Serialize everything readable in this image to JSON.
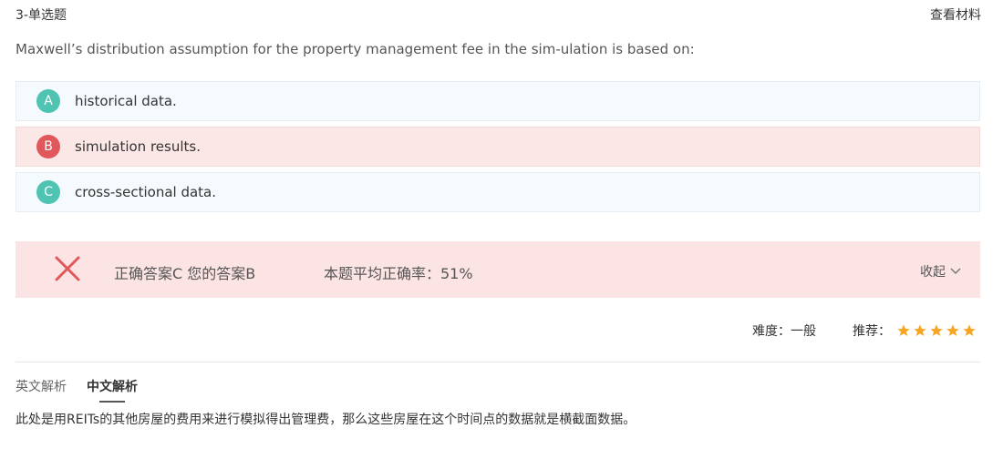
{
  "header": {
    "question_type": "3-单选题",
    "view_material": "查看材料"
  },
  "question": {
    "text": "Maxwell’s distribution assumption for the property management fee in the sim-ulation is based on:"
  },
  "options": [
    {
      "letter": "A",
      "text": "historical data.",
      "state": "neutral"
    },
    {
      "letter": "B",
      "text": "simulation results.",
      "state": "wrong"
    },
    {
      "letter": "C",
      "text": "cross-sectional data.",
      "state": "neutral"
    }
  ],
  "result": {
    "icon": "cross-icon",
    "answer_summary": "正确答案C 您的答案B",
    "average_rate": "本题平均正确率：51%",
    "collapse_label": "收起"
  },
  "meta": {
    "difficulty": "难度：一般",
    "recommend_label": "推荐：",
    "stars": 5
  },
  "tabs": [
    {
      "label": "英文解析",
      "active": false
    },
    {
      "label": "中文解析",
      "active": true
    }
  ],
  "explanation": {
    "text": "此处是用REITs的其他房屋的费用来进行模拟得出管理费，那么这些房屋在这个时间点的数据就是横截面数据。"
  },
  "colors": {
    "accent_green": "#4fc4b3",
    "wrong_red": "#e0585b",
    "star_orange": "#f5a623"
  }
}
